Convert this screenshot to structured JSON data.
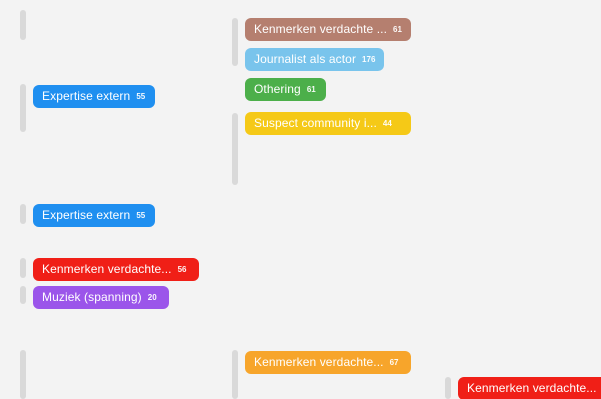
{
  "colors": {
    "background": "#f3f3f3",
    "bar": "#d9d9d9",
    "brown": "#b57f6f",
    "light_blue": "#79c4ec",
    "green": "#4caf4a",
    "yellow": "#f5c917",
    "blue": "#1f8ff0",
    "red": "#f01f17",
    "purple": "#9b55ea",
    "orange": "#f7a52b"
  },
  "column2": {
    "tag1": {
      "label": "Kenmerken verdachte ...",
      "count": "61"
    },
    "tag2": {
      "label": "Journalist als actor",
      "count": "176"
    },
    "tag3": {
      "label": "Othering",
      "count": "61"
    },
    "tag4": {
      "label": "Suspect community i...",
      "count": "44"
    },
    "tag5": {
      "label": "Kenmerken verdachte...",
      "count": "67"
    }
  },
  "column1": {
    "tag1": {
      "label": "Expertise extern",
      "count": "55"
    },
    "tag2": {
      "label": "Expertise extern",
      "count": "55"
    },
    "tag3": {
      "label": "Kenmerken verdachte...",
      "count": "56"
    },
    "tag4": {
      "label": "Muziek (spanning)",
      "count": "20"
    }
  },
  "column3": {
    "tag1": {
      "label": "Kenmerken verdachte..."
    }
  }
}
